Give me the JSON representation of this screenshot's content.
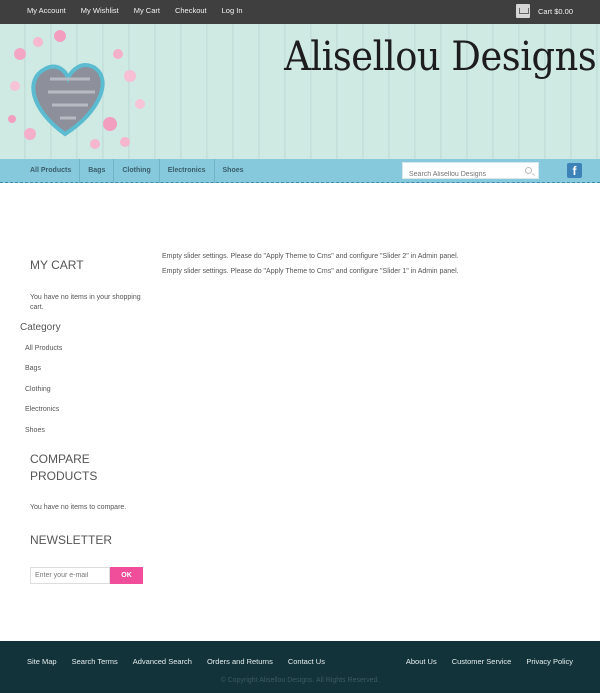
{
  "top_links": [
    "My Account",
    "My Wishlist",
    "My Cart",
    "Checkout",
    "Log In"
  ],
  "cart_summary": "Cart $0.00",
  "banner": {
    "title": "Alisellou Designs"
  },
  "nav": [
    "All Products",
    "Bags",
    "Clothing",
    "Electronics",
    "Shoes"
  ],
  "search": {
    "placeholder": "Search Alisellou Designs"
  },
  "social": {
    "facebook": "f"
  },
  "main": {
    "slider_messages": [
      "Empty slider settings. Please do \"Apply Theme to Cms\" and configure \"Slider 2\" in Admin panel.",
      "Empty slider settings. Please do \"Apply Theme to Cms\" and configure \"Slider 1\" in Admin panel."
    ]
  },
  "sidebar": {
    "cart": {
      "title": "MY CART",
      "text": "You have no items in your shopping cart."
    },
    "category": {
      "title": "Category",
      "items": [
        "All Products",
        "Bags",
        "Clothing",
        "Electronics",
        "Shoes"
      ]
    },
    "compare": {
      "title_line1": "COMPARE",
      "title_line2": "PRODUCTS",
      "text": "You have no items to compare."
    },
    "newsletter": {
      "title": "NEWSLETTER",
      "placeholder": "Enter your e-mail",
      "button": "OK"
    }
  },
  "footer": {
    "left_links": [
      "Site Map",
      "Search Terms",
      "Advanced Search",
      "Orders and Returns",
      "Contact Us"
    ],
    "right_links": [
      "About Us",
      "Customer Service",
      "Privacy Policy"
    ],
    "copyright": "© Copyright Alisellou Designs. All Rights Reserved."
  },
  "colors": {
    "topbar": "#3f3f3f",
    "nav": "#86c9dd",
    "footer": "#12333a",
    "accent": "#f04d9b"
  },
  "icons": [
    "cart-icon",
    "search-icon",
    "facebook-icon"
  ]
}
